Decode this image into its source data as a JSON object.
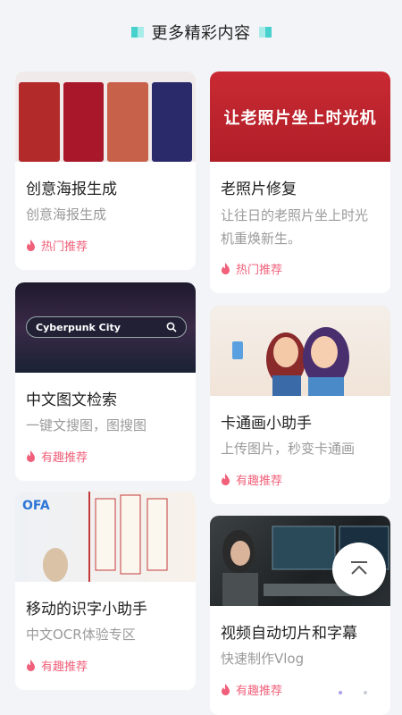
{
  "header": {
    "title": "更多精彩内容"
  },
  "cards": [
    {
      "title": "创意海报生成",
      "desc": "创意海报生成",
      "tag": "热门推荐"
    },
    {
      "title": "老照片修复",
      "desc": "让往日的老照片坐上时光机重焕新生。",
      "tag": "热门推荐",
      "image_text": "让老照片坐上时光机"
    },
    {
      "title": "中文图文检索",
      "desc": "一键文搜图，图搜图",
      "tag": "有趣推荐",
      "image_text": "Cyberpunk City"
    },
    {
      "title": "卡通画小助手",
      "desc": "上传图片，秒变卡通画",
      "tag": "有趣推荐"
    },
    {
      "title": "移动的识字小助手",
      "desc": "中文OCR体验专区",
      "tag": "有趣推荐",
      "image_text": "OFA"
    },
    {
      "title": "视频自动切片和字幕",
      "desc": "快速制作Vlog",
      "tag": "有趣推荐"
    }
  ],
  "colors": {
    "accent": "#48d1cc",
    "tag": "#f0607a",
    "photo_bg": "#c92a32"
  },
  "icons": {
    "tag": "flame-icon",
    "fab": "back-to-top-icon",
    "search": "search-icon"
  }
}
